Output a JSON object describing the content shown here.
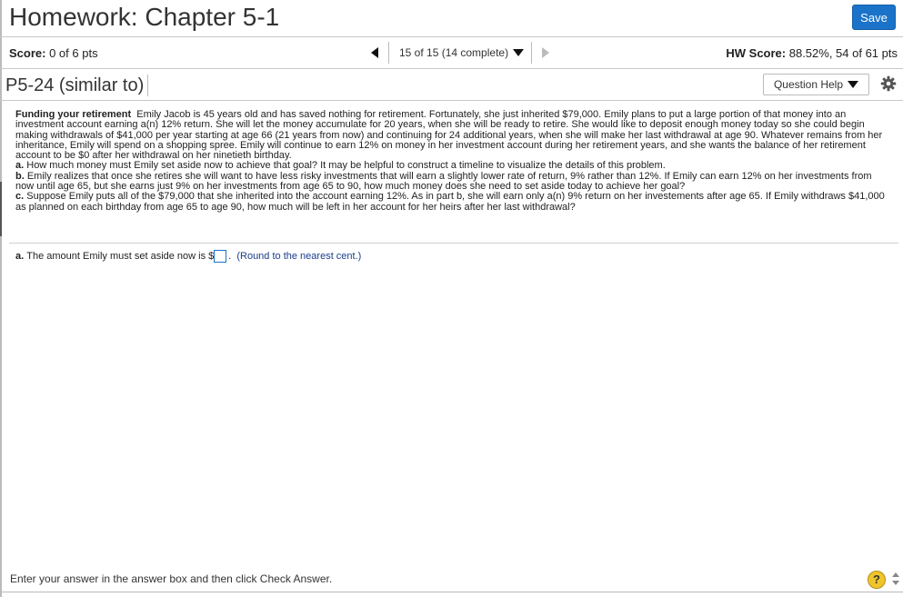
{
  "header": {
    "title": "Homework: Chapter 5-1",
    "save_label": "Save"
  },
  "score_bar": {
    "score_label": "Score:",
    "score_value": "0 of 6 pts",
    "nav_text": "15 of 15 (14 complete)",
    "hw_score_label": "HW Score:",
    "hw_score_value": "88.52%, 54 of 61 pts"
  },
  "question_bar": {
    "question_id": "P5-24 (similar to)",
    "help_label": "Question Help"
  },
  "problem": {
    "heading": "Funding your retirement",
    "intro": "Emily Jacob is 45 years old and has saved nothing for retirement. Fortunately, she just inherited $79,000. Emily plans to put a large portion of that money into an investment account earning a(n) 12% return. She will let the money accumulate for 20 years, when she will be ready to retire. She would like to deposit enough money today so she could begin making withdrawals of $41,000 per year starting at age 66 (21 years from now) and continuing for 24 additional years, when she will make her last withdrawal at age 90. Whatever remains from her inheritance, Emily will spend on a shopping spree. Emily will continue to earn 12% on money in her investment account during her retirement years, and she wants the balance of her retirement account to be $0 after her withdrawal on her ninetieth birthday.",
    "part_a_label": "a.",
    "part_a": "How much money must Emily set aside now to achieve that goal? It may be helpful to construct a timeline to visualize the details of this problem.",
    "part_b_label": "b.",
    "part_b": "Emily realizes that once she retires she will want to have less risky investments that will earn a slightly lower rate of return, 9% rather than 12%. If Emily can earn 12% on her investments from now until age 65, but she earns just 9% on her investments from age 65 to 90, how much money does she need to set aside today to achieve her goal?",
    "part_c_label": "c.",
    "part_c": "Suppose Emily puts all of the $79,000 that she inherited into the account earning 12%. As in part b, she will earn only a(n) 9% return on her investements after age 65. If Emily withdraws $41,000 as planned on each birthday from age 65 to age 90, how much will be left in her account for her heirs after her last withdrawal?"
  },
  "answer": {
    "label_prefix": "a.",
    "label_text": "The amount Emily must set aside now is $",
    "input_value": "",
    "after_box": ".",
    "round_note": "(Round to the nearest cent.)"
  },
  "footer": {
    "instruction": "Enter your answer in the answer box and then click Check Answer.",
    "help_symbol": "?"
  },
  "colors": {
    "accent": "#1a73c9",
    "help_yellow": "#f0c52c"
  },
  "icons": {
    "prev": "triangle-left-icon",
    "dropdown": "triangle-down-icon",
    "next": "triangle-right-icon",
    "settings": "gear-icon",
    "help": "question-circle-icon"
  }
}
